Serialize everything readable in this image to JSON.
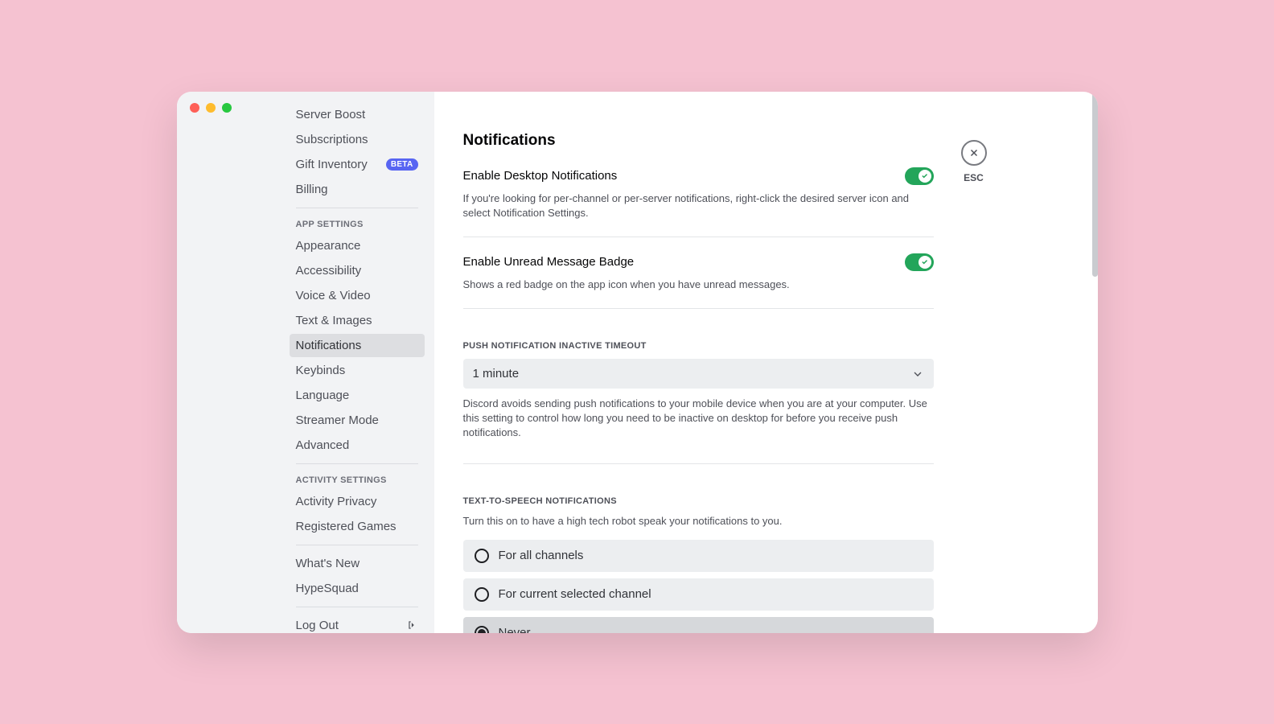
{
  "sidebar": {
    "billing_items": [
      {
        "label": "Server Boost"
      },
      {
        "label": "Subscriptions"
      },
      {
        "label": "Gift Inventory",
        "badge": "BETA"
      },
      {
        "label": "Billing"
      }
    ],
    "app_header": "APP SETTINGS",
    "app_items": [
      {
        "label": "Appearance"
      },
      {
        "label": "Accessibility"
      },
      {
        "label": "Voice & Video"
      },
      {
        "label": "Text & Images"
      },
      {
        "label": "Notifications",
        "active": true
      },
      {
        "label": "Keybinds"
      },
      {
        "label": "Language"
      },
      {
        "label": "Streamer Mode"
      },
      {
        "label": "Advanced"
      }
    ],
    "activity_header": "ACTIVITY SETTINGS",
    "activity_items": [
      {
        "label": "Activity Privacy"
      },
      {
        "label": "Registered Games"
      }
    ],
    "misc_items": [
      {
        "label": "What's New"
      },
      {
        "label": "HypeSquad"
      }
    ],
    "logout": "Log Out"
  },
  "close_label": "ESC",
  "page_title": "Notifications",
  "desktop_notif": {
    "title": "Enable Desktop Notifications",
    "desc": "If you're looking for per-channel or per-server notifications, right-click the desired server icon and select Notification Settings."
  },
  "unread_badge": {
    "title": "Enable Unread Message Badge",
    "desc": "Shows a red badge on the app icon when you have unread messages."
  },
  "push_timeout": {
    "label": "PUSH NOTIFICATION INACTIVE TIMEOUT",
    "value": "1 minute",
    "desc": "Discord avoids sending push notifications to your mobile device when you are at your computer. Use this setting to control how long you need to be inactive on desktop for before you receive push notifications."
  },
  "tts": {
    "label": "TEXT-TO-SPEECH NOTIFICATIONS",
    "desc": "Turn this on to have a high tech robot speak your notifications to you.",
    "options": {
      "all": "For all channels",
      "current": "For current selected channel",
      "never": "Never"
    }
  }
}
